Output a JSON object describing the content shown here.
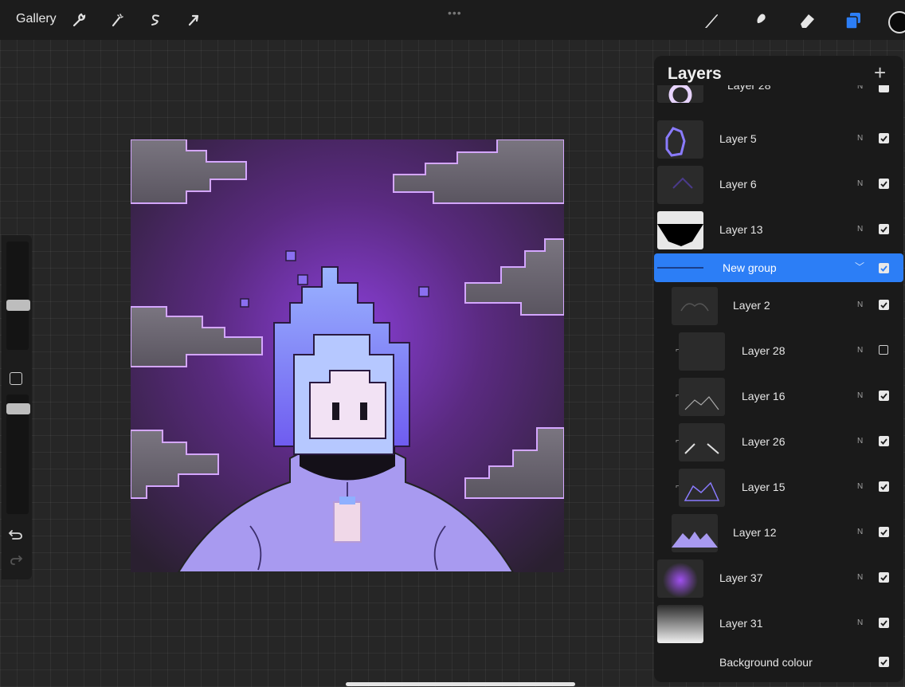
{
  "topbar": {
    "gallery_label": "Gallery",
    "menu_dots": "•••",
    "current_colour": "#0a0a0a",
    "left_tools": [
      "wrench-icon",
      "magic-wand-icon",
      "selection-icon",
      "transform-arrow-icon"
    ],
    "right_tools": [
      "brush-icon",
      "smudge-icon",
      "eraser-icon",
      "layers-icon"
    ]
  },
  "sidebar": {
    "brush_size_level": 0.36,
    "opacity_level": 0.22,
    "tools": [
      "modify-square-icon",
      "undo-icon",
      "redo-icon"
    ]
  },
  "layers_panel": {
    "title": "Layers",
    "add_label": "+",
    "layers": [
      {
        "name": "Layer 28",
        "mode": "N",
        "visible": true,
        "partial": true
      },
      {
        "name": "Layer 5",
        "mode": "N",
        "visible": true
      },
      {
        "name": "Layer 6",
        "mode": "N",
        "visible": true
      },
      {
        "name": "Layer 13",
        "mode": "N",
        "visible": true
      },
      {
        "name": "New group",
        "mode": "",
        "visible": true,
        "group": true,
        "selected": true
      },
      {
        "name": "Layer 2",
        "mode": "N",
        "visible": true
      },
      {
        "name": "Layer 28",
        "mode": "N",
        "visible": false,
        "clipped": true
      },
      {
        "name": "Layer 16",
        "mode": "N",
        "visible": true,
        "clipped": true
      },
      {
        "name": "Layer 26",
        "mode": "N",
        "visible": true,
        "clipped": true
      },
      {
        "name": "Layer 15",
        "mode": "N",
        "visible": true,
        "clipped": true
      },
      {
        "name": "Layer 12",
        "mode": "N",
        "visible": true
      },
      {
        "name": "Layer 37",
        "mode": "N",
        "visible": true
      },
      {
        "name": "Layer 31",
        "mode": "N",
        "visible": true
      },
      {
        "name": "Background colour",
        "mode": "",
        "visible": true,
        "background": true
      }
    ]
  },
  "colors": {
    "accent": "#2c7ef6",
    "canvas_purple": "#8a3fd8",
    "hoodie": "#a89af0"
  }
}
